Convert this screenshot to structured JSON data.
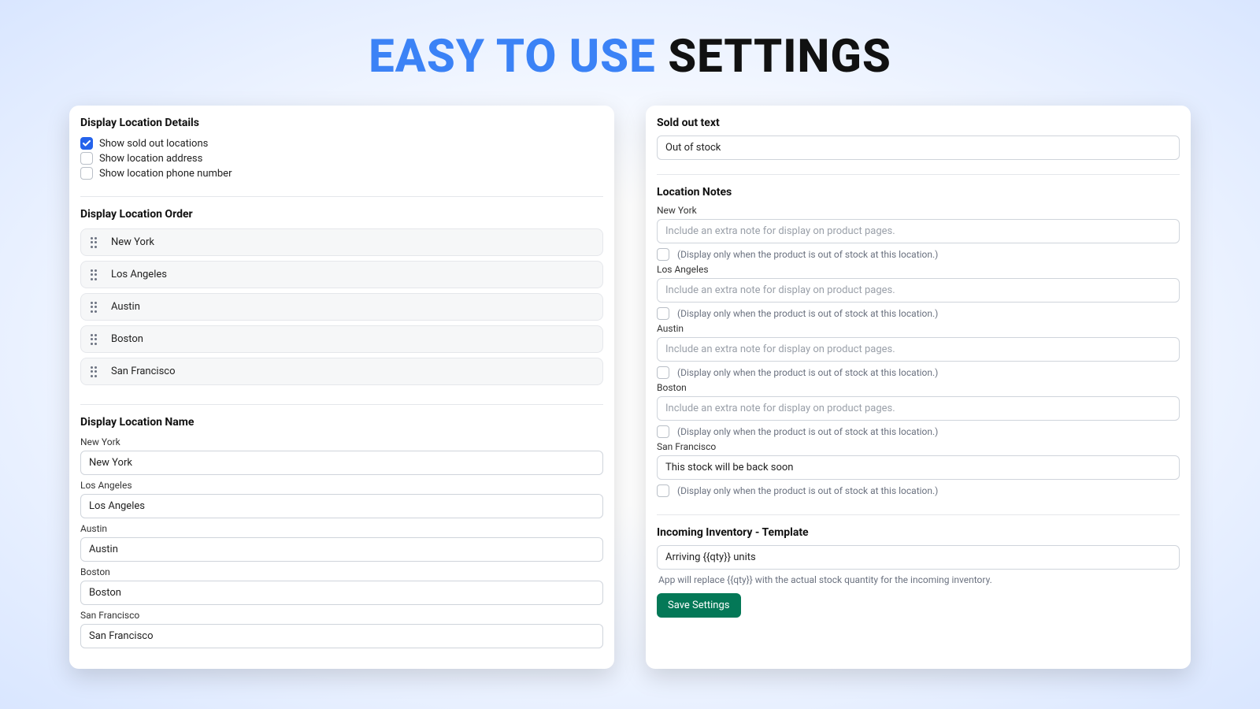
{
  "title": {
    "blue": "EASY TO USE",
    "black": "SETTINGS"
  },
  "left": {
    "details": {
      "heading": "Display Location Details",
      "checks": [
        {
          "label": "Show sold out locations",
          "checked": true
        },
        {
          "label": "Show location address",
          "checked": false
        },
        {
          "label": "Show location phone number",
          "checked": false
        }
      ]
    },
    "order": {
      "heading": "Display Location Order",
      "items": [
        "New York",
        "Los Angeles",
        "Austin",
        "Boston",
        "San Francisco"
      ]
    },
    "names": {
      "heading": "Display Location Name",
      "rows": [
        {
          "label": "New York",
          "value": "New York"
        },
        {
          "label": "Los Angeles",
          "value": "Los Angeles"
        },
        {
          "label": "Austin",
          "value": "Austin"
        },
        {
          "label": "Boston",
          "value": "Boston"
        },
        {
          "label": "San Francisco",
          "value": "San Francisco"
        }
      ]
    }
  },
  "right": {
    "soldOut": {
      "heading": "Sold out text",
      "value": "Out of stock"
    },
    "notes": {
      "heading": "Location Notes",
      "placeholder": "Include an extra note for display on product pages.",
      "hint": "(Display only when the product is out of stock at this location.)",
      "rows": [
        {
          "label": "New York",
          "value": ""
        },
        {
          "label": "Los Angeles",
          "value": ""
        },
        {
          "label": "Austin",
          "value": ""
        },
        {
          "label": "Boston",
          "value": ""
        },
        {
          "label": "San Francisco",
          "value": "This stock will be back soon"
        }
      ]
    },
    "incoming": {
      "heading": "Incoming Inventory - Template",
      "value": "Arriving {{qty}} units",
      "helper": "App will replace {{qty}} with the actual stock quantity for the incoming inventory."
    },
    "save": "Save Settings"
  }
}
